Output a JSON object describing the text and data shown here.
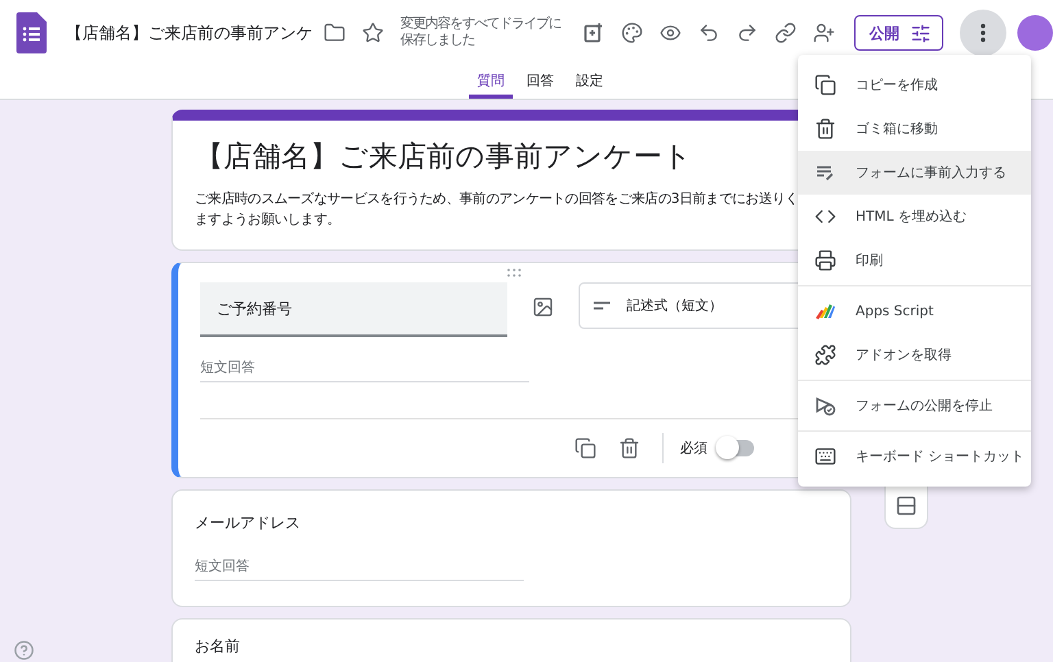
{
  "header": {
    "title": "【店舗名】ご来店前の事前アンケ",
    "save_status": [
      "変更内容をすべてドライブに",
      "保存しました"
    ],
    "publish_button": "公開"
  },
  "tabs": [
    {
      "label": "質問",
      "selected": true
    },
    {
      "label": "回答",
      "selected": false
    },
    {
      "label": "設定",
      "selected": false
    }
  ],
  "form": {
    "title": "【店舗名】ご来店前の事前アンケート",
    "description": [
      "ご来店時のスムーズなサービスを行うため、事前のアンケートの回答をご来店の3日前までにお送りく",
      "ますようお願いします。"
    ]
  },
  "questions": [
    {
      "title": "ご予約番号",
      "selected": true,
      "type": "記述式（短文）",
      "answer_placeholder": "短文回答",
      "required_label": "必須",
      "required": false
    },
    {
      "title": "メールアドレス",
      "selected": false,
      "answer_placeholder": "短文回答"
    },
    {
      "title": "お名前",
      "selected": false
    }
  ],
  "menu": {
    "groups": [
      [
        {
          "label": "コピーを作成",
          "selected": false
        },
        {
          "label": "ゴミ箱に移動",
          "selected": false
        },
        {
          "label": "フォームに事前入力する",
          "selected": true
        },
        {
          "label": "HTML を埋め込む",
          "selected": false
        },
        {
          "label": "印刷",
          "selected": false
        }
      ],
      [
        {
          "label": "Apps Script",
          "selected": false
        },
        {
          "label": "アドオンを取得",
          "selected": false
        }
      ],
      [
        {
          "label": "フォームの公開を停止",
          "selected": false
        }
      ],
      [
        {
          "label": "キーボード ショートカット",
          "selected": false
        }
      ]
    ]
  }
}
